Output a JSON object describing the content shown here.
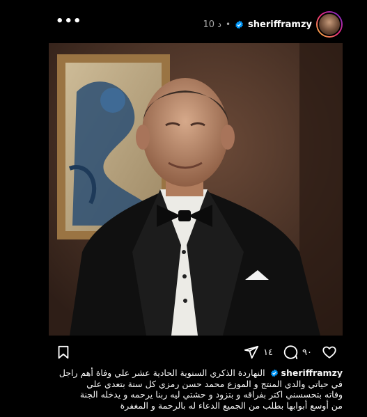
{
  "post": {
    "author": {
      "username": "sherifframzy",
      "verified": true,
      "time": "10 د",
      "separator": "•"
    },
    "more_icon": "more-horizontal-icon",
    "photo": {
      "icons": [
        "portrait-photo"
      ],
      "colors": {
        "wall": "#4a3428",
        "frame": "#b08a55",
        "painting": "#2c4f73",
        "tuxedo": "#111111",
        "shirt": "#ecebe6"
      }
    },
    "actions": {
      "like_count": "٩٠",
      "comment_count": "١٤",
      "icons": [
        "heart-icon",
        "comment-icon",
        "share-icon",
        "bookmark-icon"
      ]
    },
    "caption": {
      "username": "sherifframzy",
      "lines": [
        "النهاردة الذكري السنوية الحادية عشر علي وفاة أهم راجل",
        "في حياتي والدي المنتج و الموزع محمد حسن رمزي كل سنة بتعدي علي",
        "وفاته بتحسسني اكتر بفراقه و بتزود و حشتي ليه ربنا يرحمه و يدخله الجنة",
        "من أوسع أبوابها بطلب من الجميع الدعاء له بالرحمة و المغفرة"
      ]
    }
  }
}
